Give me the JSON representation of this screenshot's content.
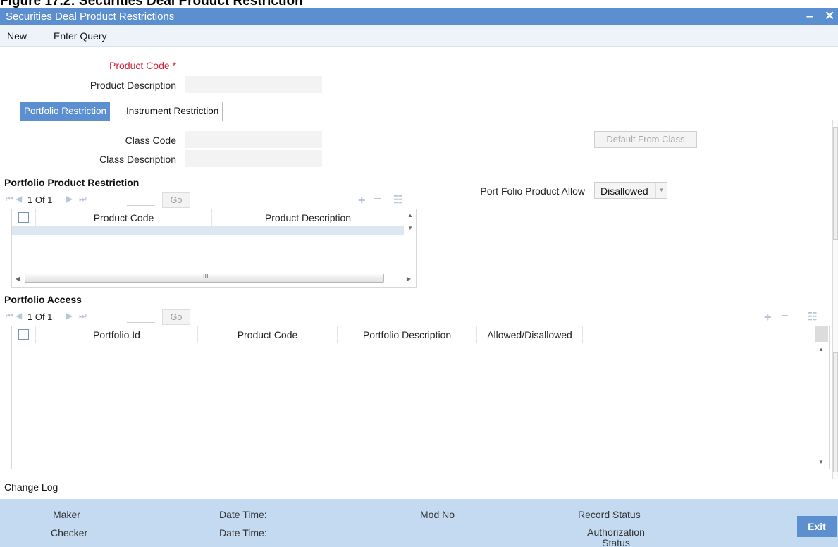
{
  "caption": "Figure 17.2: Securities Deal Product Restriction",
  "window": {
    "title": "Securities Deal Product Restrictions",
    "minimize": "–",
    "close": "✕"
  },
  "menu": {
    "new": "New",
    "enter_query": "Enter Query"
  },
  "header": {
    "product_code_label": "Product Code",
    "required_mark": "*",
    "product_code_value": "",
    "product_description_label": "Product Description",
    "product_description_value": ""
  },
  "tabs": [
    {
      "label": "Portfolio Restriction",
      "active": true
    },
    {
      "label": "Instrument Restriction",
      "active": false
    }
  ],
  "class": {
    "class_code_label": "Class Code",
    "class_code_value": "",
    "class_description_label": "Class Description",
    "class_description_value": "",
    "default_button": "Default From Class"
  },
  "portfolio_product_restriction": {
    "title": "Portfolio Product Restriction",
    "pager": {
      "text": "1 Of 1",
      "go": "Go"
    },
    "columns": [
      "Product Code",
      "Product Description"
    ]
  },
  "port_folio_allow": {
    "label": "Port Folio Product Allow",
    "value": "Disallowed"
  },
  "portfolio_access": {
    "title": "Portfolio Access",
    "pager": {
      "text": "1 Of 1",
      "go": "Go"
    },
    "columns": [
      "Portfolio Id",
      "Product Code",
      "Portfolio Description",
      "Allowed/Disallowed"
    ]
  },
  "footer": {
    "change_log": "Change Log",
    "maker": "Maker",
    "checker": "Checker",
    "date_time_1": "Date Time:",
    "date_time_2": "Date Time:",
    "mod_no": "Mod No",
    "record_status": "Record Status",
    "authorization_status": "Authorization Status",
    "exit": "Exit"
  },
  "colors": {
    "accent": "#5c8fcf",
    "audit_bg": "#c4daf0",
    "required": "#d0243a"
  }
}
